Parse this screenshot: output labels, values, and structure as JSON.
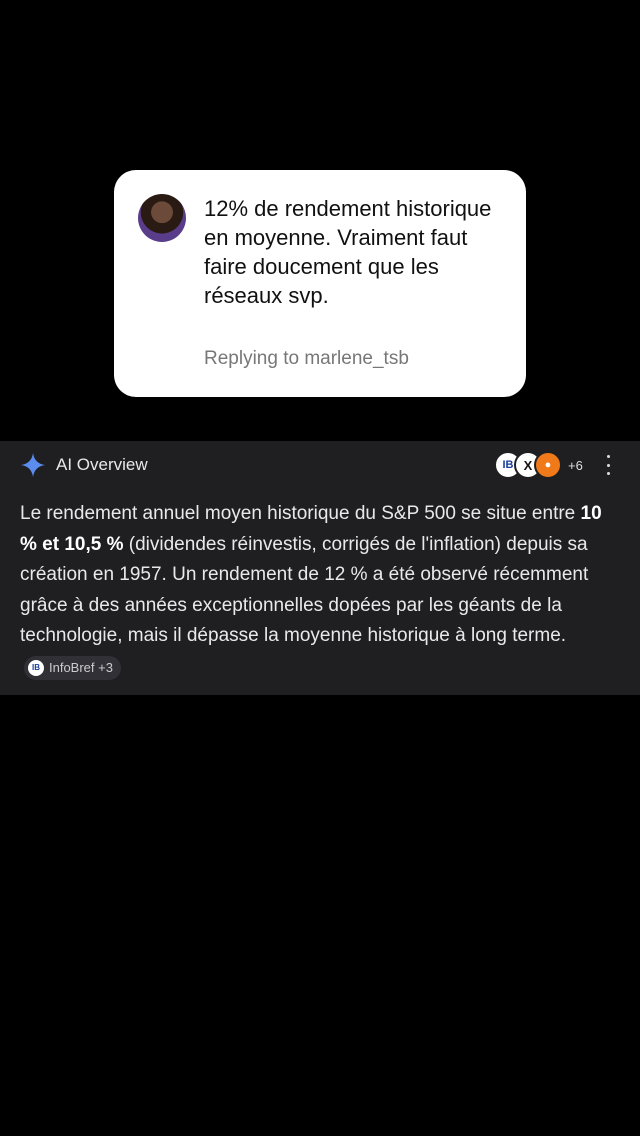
{
  "reply": {
    "text": "12% de rendement historique en moyenne. Vraiment faut faire doucement que les réseaux svp.",
    "replying_to": "Replying to marlene_tsb"
  },
  "ai_overview": {
    "title": "AI Overview",
    "sources": {
      "icons": [
        "IB",
        "X",
        "orange-source"
      ],
      "count_label": "+6"
    },
    "body": {
      "part1": "Le rendement annuel moyen historique du S&P 500 se situe entre ",
      "bold": "10 % et 10,5 %",
      "part2": " (dividendes réinvestis, corrigés de l'inflation) depuis sa création en 1957. Un rendement de 12 % a été observé récemment grâce à des années exceptionnelles dopées par les géants de la technologie, mais il dépasse la moyenne historique à long terme."
    },
    "citation": {
      "logo": "IB",
      "label": "InfoBref +3"
    },
    "colors": {
      "sparkle": "#5b8def",
      "panel_bg": "#1f1f22"
    }
  }
}
